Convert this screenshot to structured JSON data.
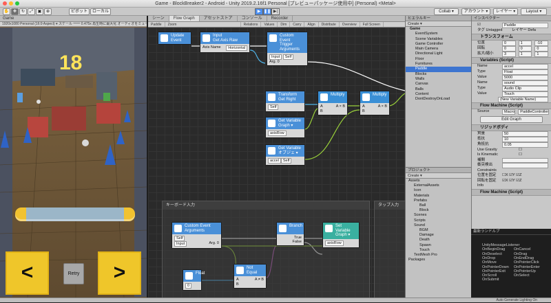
{
  "window": {
    "title": "Game - BlockBreaker2 - Android - Unity 2019.2.16f1 Personal [プレビューパッケージ使用中] (Personal) <Metal>"
  },
  "toolbar": {
    "left": [
      "ピボット",
      "ローカル"
    ],
    "right": [
      "Collab ▾",
      "アカウント ▾",
      "レイヤー ▾",
      "Layout ▾"
    ]
  },
  "game": {
    "tab": "Game",
    "bar": "1920x1080 Personal (16:9 Aspect) ▾   スケール ━━ 0.475x   再生時に最大化  オーディオをミュート  Stats  Gizmos ▾",
    "score": "18",
    "left_btn": "<",
    "retry": "Retry",
    "right_btn": ">"
  },
  "graph": {
    "tabs": [
      "シーン",
      "Flow Graph",
      "アセットストア",
      "コンソール",
      "Recorder"
    ],
    "bar": [
      "Paddle",
      "Zoom",
      "Relations",
      "Values",
      "Dim",
      "Carry",
      "Align",
      "Distribute",
      "Overview",
      "Full Screen"
    ],
    "groups": [
      "キーボード入力",
      "タップ入力"
    ],
    "nodes": {
      "update": {
        "title": "Update",
        "sub": "Event"
      },
      "input": {
        "title": "Input",
        "sub": "Get Axis Raw",
        "label": "Axis Name",
        "value": "Horizontal"
      },
      "trigger": {
        "title": "Custom Event",
        "sub": "Trigger",
        "label": "Arguments",
        "count": "1",
        "f1": "Input",
        "f2": "Self",
        "f3": "Arg. 0"
      },
      "transform": {
        "title": "Transform",
        "sub": "Get Right",
        "f1": "Self"
      },
      "getvar1": {
        "title": "Get Variable",
        "sub": "Graph ▾",
        "f1": "axisRow"
      },
      "getvar2": {
        "title": "Get Variable",
        "sub": "オブジェ ▾",
        "f1": "accel",
        "f2": "Self"
      },
      "mult1": {
        "title": "Multiply",
        "a": "A",
        "b": "B",
        "out": "A × B"
      },
      "mult2": {
        "title": "Multiply",
        "a": "A",
        "b": "B",
        "out": "A × B"
      },
      "custom": {
        "title": "Custom Event",
        "sub": "Arguments",
        "count": "1",
        "f1": "Self",
        "f2": "Input",
        "out": "Arg. 0"
      },
      "branch": {
        "title": "Branch",
        "t": "True",
        "f": "False"
      },
      "setvar": {
        "title": "Set Variable",
        "sub": "Graph ▾",
        "f1": "axisRow"
      },
      "float": {
        "title": "Float",
        "value": "0"
      },
      "notequal": {
        "title": "Not Equal",
        "a": "A",
        "b": "B",
        "out": "A ≠ B"
      }
    }
  },
  "hierarchy": {
    "title": "ヒエラルキー",
    "create": "Create ▾",
    "root": "Game",
    "items": [
      "EventSystem",
      "Scene Variables",
      "Game Controller",
      "Main Camera",
      "Directional Light",
      "Floor",
      "Furnitures",
      "Paddle",
      "Blocks",
      "Walls",
      "Canvas",
      "Balls",
      "Content",
      "DontDestroyOnLoad"
    ],
    "selected": "Paddle"
  },
  "project": {
    "title": "プロジェクト",
    "create": "Create ▾",
    "items": [
      "Assets",
      "ExternalAssets",
      "Icon",
      "Materials",
      "Prefabs",
      "Ball",
      "Block",
      "Scenes",
      "Scripts",
      "Sound",
      "BGM",
      "Damage",
      "Death",
      "Spawn",
      "Touch",
      "TextMesh Pro",
      "Packages"
    ]
  },
  "inspector": {
    "title": "インスペクター",
    "object": "Paddle",
    "tag": "タグ Untagged",
    "layer": "レイヤー Defa",
    "sections": {
      "transform": "トランスフォーム",
      "variables": "Variables (Script)",
      "flow1": "Flow Machine (Script)",
      "rigidbody": "リジッドボディ",
      "flow2": "Flow Machine (Script)"
    },
    "position": {
      "label": "位置",
      "x": "0",
      "y": "1",
      "z": "-10"
    },
    "rotation": {
      "label": "回転",
      "x": "0",
      "y": "0",
      "z": "0"
    },
    "scale": {
      "label": "拡大/縮小",
      "x": "3",
      "y": "1",
      "z": "1"
    },
    "var1": {
      "name": "accel",
      "type": "Float",
      "value": "5000"
    },
    "var2": {
      "name": "sound",
      "type": "Audio Clip",
      "value": "Touch"
    },
    "new_var": "(New Variable Name)",
    "source": "Macro",
    "macro": "PaddleController",
    "edit_graph": "Edit Graph",
    "rb": {
      "mass": "50",
      "drag": "10",
      "angular": "0.05",
      "gravity": "Use Gravity",
      "kinematic": "Is Kinematic",
      "interp": "補間",
      "collision": "衝突検出",
      "constraints": "Constraints",
      "freeze_pos": "位置を固定",
      "freeze_rot": "回転を固定",
      "info": "Info"
    }
  },
  "messages": {
    "title": "最新ランドルブ",
    "list_title": "UnityMessageListener",
    "col1": [
      "OnBeginDrag",
      "OnDeselect",
      "OnDrop",
      "OnMove",
      "OnPointerDown",
      "OnPointerExit",
      "OnScroll",
      "OnSubmit"
    ],
    "col2": [
      "OnCancel",
      "OnDrag",
      "OnEndDrag",
      "OnPointerClick",
      "OnPointerEnter",
      "OnPointerUp",
      "OnSelect",
      ""
    ]
  },
  "status": "Auto Generate Lighting On",
  "colors": {
    "accent": "#3d75d0",
    "button_yellow": "#efc62a",
    "score": "#ffe45a"
  }
}
